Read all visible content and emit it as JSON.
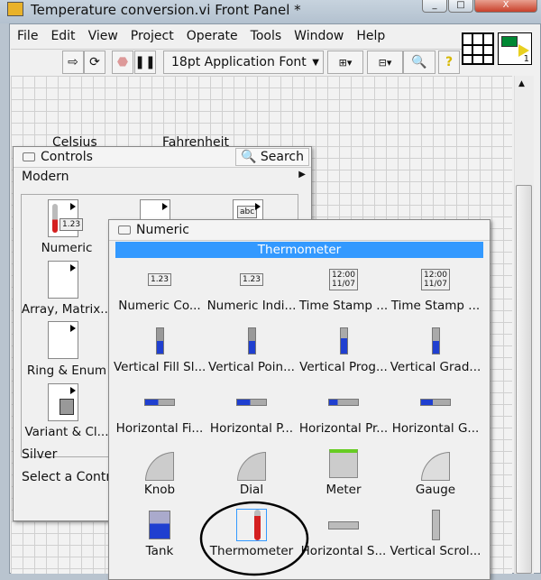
{
  "window": {
    "title": "Temperature conversion.vi Front Panel *",
    "buttons": [
      "minimize",
      "maximize",
      "close"
    ]
  },
  "menu": [
    "File",
    "Edit",
    "View",
    "Project",
    "Operate",
    "Tools",
    "Window",
    "Help"
  ],
  "toolbar": {
    "font_select": "18pt Application Font",
    "icons": [
      "run-arrow-icon",
      "run-continuously-icon",
      "abort-icon",
      "pause-icon",
      "align-icon",
      "distribute-icon",
      "zoom-search-icon",
      "help-icon"
    ]
  },
  "vi_icon": {
    "number": "1"
  },
  "canvas": {
    "labels": [
      "Celsius",
      "Fahrenheit"
    ]
  },
  "controls_palette": {
    "title": "Controls",
    "search": "Search",
    "sections": [
      "Modern",
      "Silver",
      "Select a Control..."
    ],
    "silver": "Silver",
    "select": "Select a Contro",
    "modern": "Modern",
    "categories": [
      {
        "label": "Numeric"
      },
      {
        "label": "Array, Matrix..."
      },
      {
        "label": "Ring & Enum"
      },
      {
        "label": "Variant & Cl..."
      }
    ]
  },
  "numeric_palette": {
    "title": "Numeric",
    "highlight": "Thermometer",
    "items": [
      "Numeric Co...",
      "Numeric Indi...",
      "Time Stamp ...",
      "Time Stamp ...",
      "Vertical Fill Sl...",
      "Vertical Poin...",
      "Vertical Prog...",
      "Vertical Grad...",
      "Horizontal Fi...",
      "Horizontal P...",
      "Horizontal Pr...",
      "Horizontal G...",
      "Knob",
      "Dial",
      "Meter",
      "Gauge",
      "Tank",
      "Thermometer",
      "Horizontal S...",
      "Vertical Scrol..."
    ],
    "selected": "Thermometer"
  },
  "colors": {
    "highlight_bar": "#3399ff",
    "fill_blue": "#1f3fd0",
    "thermo_red": "#d42020"
  }
}
